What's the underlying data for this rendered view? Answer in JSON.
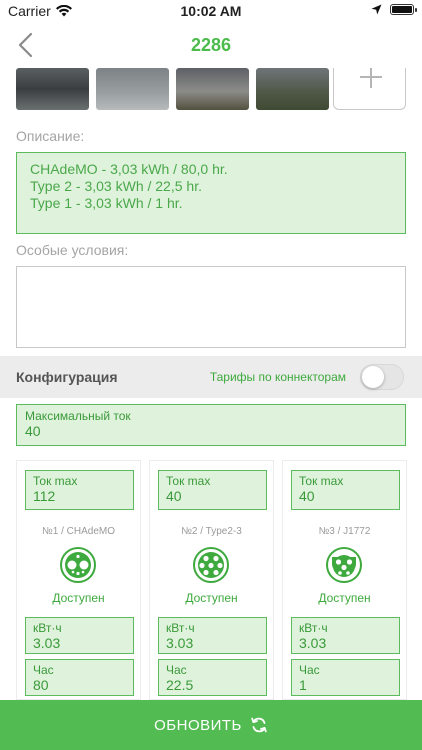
{
  "status_bar": {
    "carrier": "Carrier",
    "time": "10:02 AM"
  },
  "nav": {
    "title": "2286"
  },
  "photos": {
    "count": 4
  },
  "description": {
    "label": "Описание:",
    "lines": [
      "CHAdeMO - 3,03 kWh / 80,0 hr.",
      "Type 2 - 3,03 kWh / 22,5 hr.",
      "Type 1 - 3,03 kWh / 1 hr."
    ]
  },
  "special_conditions": {
    "label": "Особые условия:",
    "value": ""
  },
  "config": {
    "title": "Конфигурация",
    "tariff_label": "Тарифы по коннекторам",
    "tariff_enabled": false
  },
  "max_current": {
    "label": "Максимальный ток",
    "value": "40"
  },
  "connectors": [
    {
      "tok_label": "Ток max",
      "tok_value": "112",
      "name": "№1 / CHAdeMO",
      "icon": "chademo-connector-icon",
      "status": "Доступен",
      "kwh_label": "кВт·ч",
      "kwh_value": "3.03",
      "hours_label": "Час",
      "hours_value": "80"
    },
    {
      "tok_label": "Ток max",
      "tok_value": "40",
      "name": "№2 / Type2-3",
      "icon": "type2-connector-icon",
      "status": "Доступен",
      "kwh_label": "кВт·ч",
      "kwh_value": "3.03",
      "hours_label": "Час",
      "hours_value": "22.5"
    },
    {
      "tok_label": "Ток max",
      "tok_value": "40",
      "name": "№3 / J1772",
      "icon": "j1772-connector-icon",
      "status": "Доступен",
      "kwh_label": "кВт·ч",
      "kwh_value": "3.03",
      "hours_label": "Час",
      "hours_value": "1"
    }
  ],
  "update_button": {
    "label": "ОБНОВИТЬ",
    "icon": "refresh-icon"
  },
  "colors": {
    "accent": "#52bc52",
    "field_bg": "#dff2dc",
    "field_border": "#5cbb5c",
    "text_green": "#3a9a3a"
  }
}
